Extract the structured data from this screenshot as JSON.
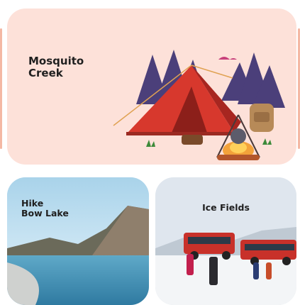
{
  "cards": [
    {
      "title_lines": [
        "Mosquito",
        "Creek"
      ],
      "image": "camping-tent-illustration"
    },
    {
      "title_lines": [
        "Hike",
        "Bow Lake"
      ],
      "image": "mountain-lake-photo"
    },
    {
      "title": "Ice Fields",
      "image": "glacier-snowcoach-photo"
    }
  ],
  "colors": {
    "card1_bg": "#fde1d9",
    "tent_red": "#d7382d",
    "tree_purple": "#4b3f7a"
  }
}
